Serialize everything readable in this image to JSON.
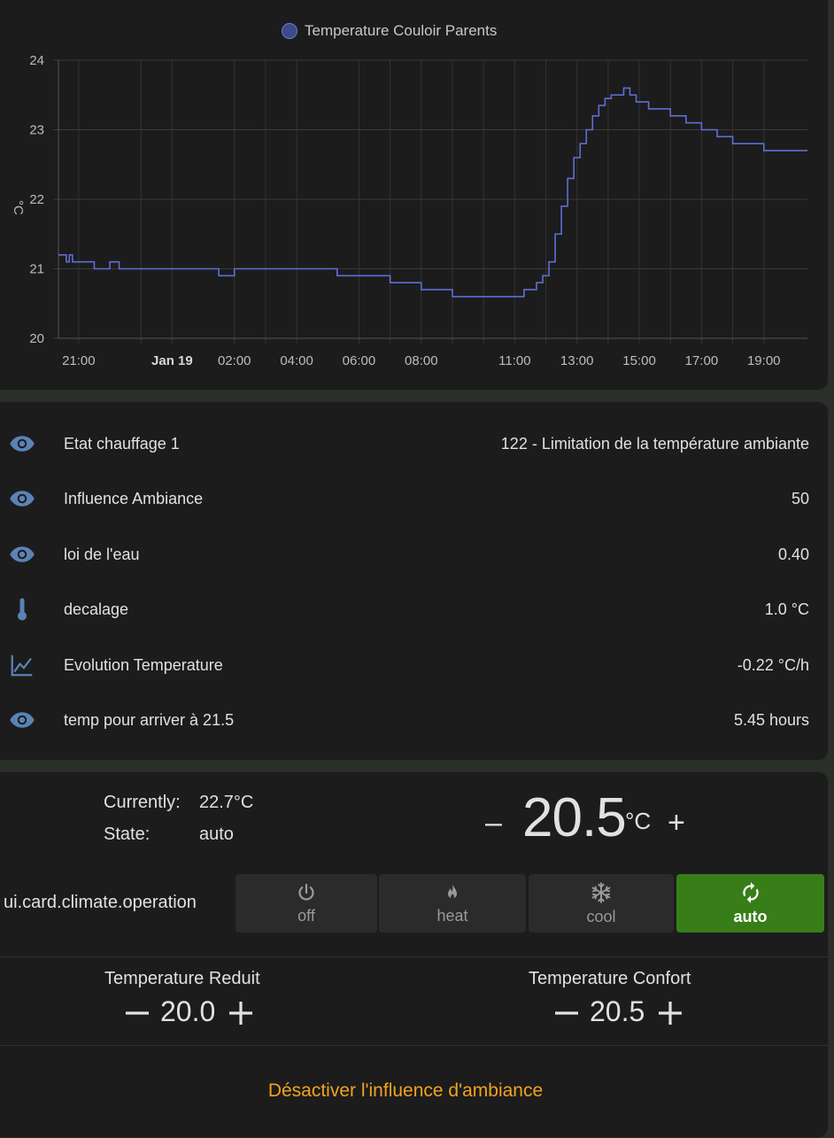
{
  "chart": {
    "legend": "Temperature Couloir Parents",
    "ylabel": "°C",
    "series_color": "#5c6fd6"
  },
  "chart_data": {
    "type": "line",
    "title": "",
    "series": [
      {
        "name": "Temperature Couloir Parents",
        "x": [
          20.4,
          20.5,
          20.6,
          20.7,
          20.8,
          21.3,
          21.5,
          22.0,
          22.3,
          22.5,
          22.6,
          23.0,
          24.0,
          25.5,
          25.7,
          26.0,
          26.2,
          26.5,
          27.0,
          28.0,
          28.5,
          29.3,
          29.8,
          30.0,
          31.0,
          32.0,
          33.0,
          33.5,
          34.0,
          34.5,
          35.0,
          35.2,
          35.3,
          35.5,
          35.7,
          35.9,
          36.1,
          36.3,
          36.5,
          36.7,
          36.9,
          37.1,
          37.3,
          37.5,
          37.7,
          37.9,
          38.1,
          38.3,
          38.5,
          38.7,
          38.9,
          39.1,
          39.3,
          39.5,
          39.7,
          40.0,
          40.5,
          41.0,
          41.5,
          42.0,
          42.5,
          43.0,
          43.5,
          44.0,
          44.4
        ],
        "values": [
          21.2,
          21.2,
          21.1,
          21.2,
          21.1,
          21.1,
          21.0,
          21.1,
          21.0,
          21.0,
          21.0,
          21.0,
          21.0,
          20.9,
          20.9,
          21.0,
          21.0,
          21.0,
          21.0,
          21.0,
          21.0,
          20.9,
          20.9,
          20.9,
          20.8,
          20.7,
          20.6,
          20.6,
          20.6,
          20.6,
          20.6,
          20.6,
          20.7,
          20.7,
          20.8,
          20.9,
          21.1,
          21.5,
          21.9,
          22.3,
          22.6,
          22.8,
          23.0,
          23.2,
          23.35,
          23.45,
          23.5,
          23.5,
          23.6,
          23.5,
          23.4,
          23.4,
          23.3,
          23.3,
          23.3,
          23.2,
          23.1,
          23.0,
          22.9,
          22.8,
          22.8,
          22.7,
          22.7,
          22.7,
          22.7
        ]
      }
    ],
    "x_tick_labels": [
      "21:00",
      "Jan 19",
      "02:00",
      "04:00",
      "06:00",
      "08:00",
      "11:00",
      "13:00",
      "15:00",
      "17:00",
      "19:00"
    ],
    "x_tick_hours": [
      21,
      24,
      26,
      28,
      30,
      32,
      35,
      37,
      39,
      41,
      43
    ],
    "xlim": [
      20.35,
      44.4
    ],
    "y_ticks": [
      "20",
      "21",
      "22",
      "23",
      "24"
    ],
    "ylim": [
      20,
      24
    ],
    "ylabel": "°C",
    "grid": true,
    "legend_position": "top-center"
  },
  "entities": [
    {
      "icon": "eye-icon",
      "name": "Etat chauffage 1",
      "value": "122 - Limitation de la température ambiante"
    },
    {
      "icon": "eye-icon",
      "name": "Influence Ambiance",
      "value": "50"
    },
    {
      "icon": "eye-icon",
      "name": "loi de l'eau",
      "value": "0.40"
    },
    {
      "icon": "thermometer-icon",
      "name": "decalage",
      "value": "1.0 °C"
    },
    {
      "icon": "chart-line-icon",
      "name": "Evolution Temperature",
      "value": "-0.22 °C/h"
    },
    {
      "icon": "eye-icon",
      "name": "temp pour arriver à 21.5",
      "value": "5.45 hours"
    }
  ],
  "climate": {
    "currently_label": "Currently:",
    "currently_value": "22.7°C",
    "state_label": "State:",
    "state_value": "auto",
    "target": "20.5",
    "unit": "°C",
    "minus": "–",
    "plus": "+",
    "operation_label": "ui.card.climate.operation",
    "modes": [
      {
        "icon": "power-icon",
        "label": "off",
        "active": false
      },
      {
        "icon": "flame-icon",
        "label": "heat",
        "active": false
      },
      {
        "icon": "snowflake-icon",
        "label": "cool",
        "active": false
      },
      {
        "icon": "autorenew-icon",
        "label": "auto",
        "active": true
      }
    ],
    "active_color": "#377e18"
  },
  "presets": [
    {
      "title": "Temperature Reduit",
      "value": "20.0"
    },
    {
      "title": "Temperature Confort",
      "value": "20.5"
    }
  ],
  "action": {
    "label": "Désactiver l'influence d'ambiance",
    "color": "#f2a31f"
  }
}
